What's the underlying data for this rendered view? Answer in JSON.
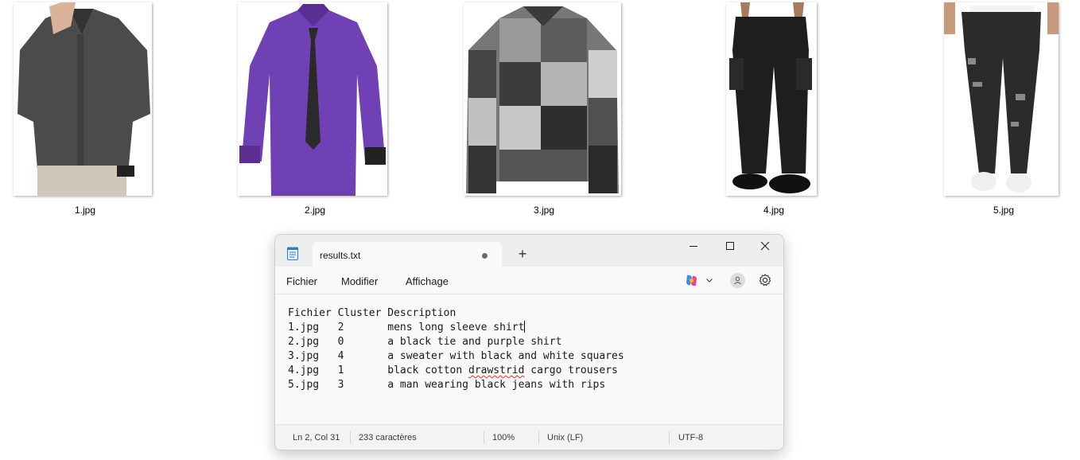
{
  "thumbnails": [
    {
      "filename": "1.jpg",
      "subject": "grey long sleeve shirt"
    },
    {
      "filename": "2.jpg",
      "subject": "purple shirt with black tie"
    },
    {
      "filename": "3.jpg",
      "subject": "black and white patchwork sweater"
    },
    {
      "filename": "4.jpg",
      "subject": "black cargo trousers"
    },
    {
      "filename": "5.jpg",
      "subject": "ripped black jeans"
    }
  ],
  "notepad": {
    "tab_title": "results.txt",
    "new_tab_symbol": "+",
    "menu": {
      "file": "Fichier",
      "edit": "Modifier",
      "view": "Affichage"
    },
    "icons": {
      "app": "notepad-icon",
      "copilot": "copilot-icon",
      "account": "account-icon",
      "settings": "gear-icon"
    },
    "content": {
      "header": "Fichier Cluster Description",
      "rows": [
        {
          "file": "1.jpg",
          "cluster": "2",
          "description": "mens long sleeve shirt"
        },
        {
          "file": "2.jpg",
          "cluster": "0",
          "description": "a black tie and purple shirt"
        },
        {
          "file": "3.jpg",
          "cluster": "4",
          "description": "a sweater with black and white squares"
        },
        {
          "file": "4.jpg",
          "cluster": "1",
          "description_before": "black cotton ",
          "description_misspelled": "drawstrid",
          "description_after": " cargo trousers"
        },
        {
          "file": "5.jpg",
          "cluster": "3",
          "description": "a man wearing black jeans with rips"
        }
      ]
    },
    "status": {
      "position": "Ln 2, Col 31",
      "char_count": "233 caractères",
      "zoom": "100%",
      "line_ending": "Unix (LF)",
      "encoding": "UTF-8"
    },
    "colors": {
      "titlebar": "#eeeeee",
      "editor_bg": "#f9f9f9",
      "spell_error": "#d03a2a"
    }
  }
}
